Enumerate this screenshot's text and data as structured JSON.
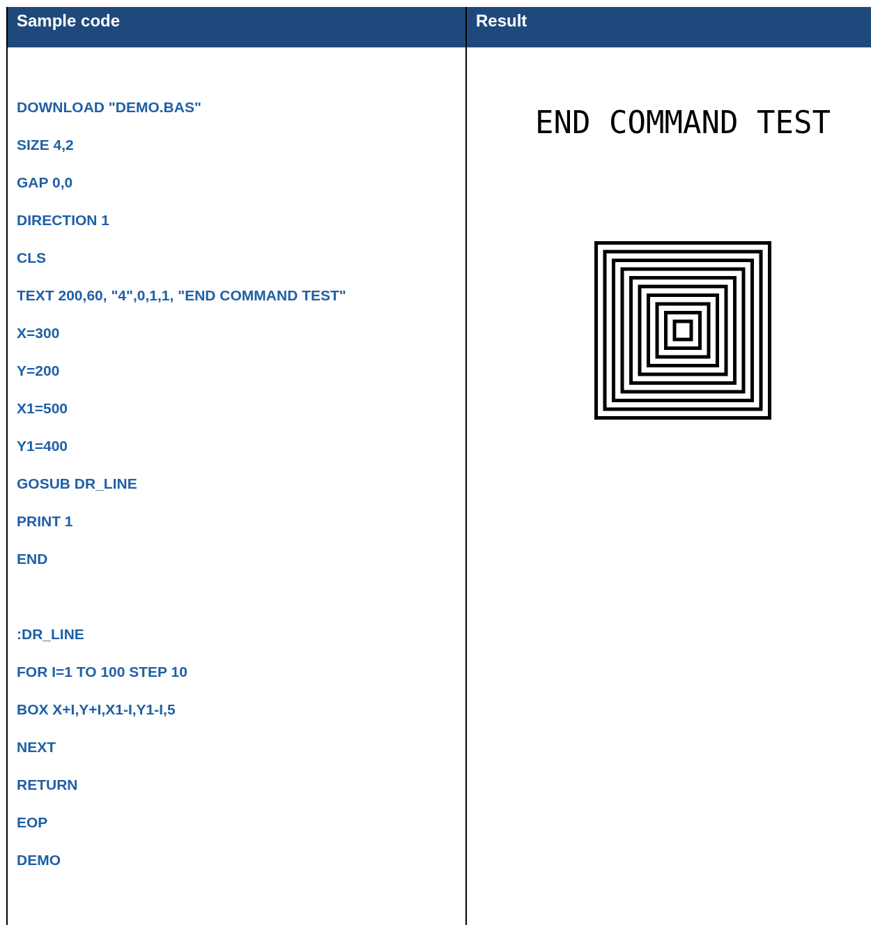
{
  "table": {
    "columns": [
      "Sample code",
      "Result"
    ],
    "code_blocks": [
      [
        "DOWNLOAD \"DEMO.BAS\"",
        "SIZE 4,2",
        "GAP 0,0",
        "DIRECTION 1",
        "CLS",
        "TEXT 200,60, \"4\",0,1,1, \"END COMMAND TEST\"",
        "X=300",
        "Y=200",
        "X1=500",
        "Y1=400",
        "GOSUB DR_LINE",
        "PRINT 1",
        "END"
      ],
      [
        ":DR_LINE",
        "FOR I=1 TO 100 STEP 10",
        "BOX X+I,Y+I,X1-I,Y1-I,5",
        "NEXT",
        "RETURN",
        "EOP",
        "DEMO"
      ]
    ],
    "result": {
      "label_text": "END COMMAND TEST"
    }
  }
}
